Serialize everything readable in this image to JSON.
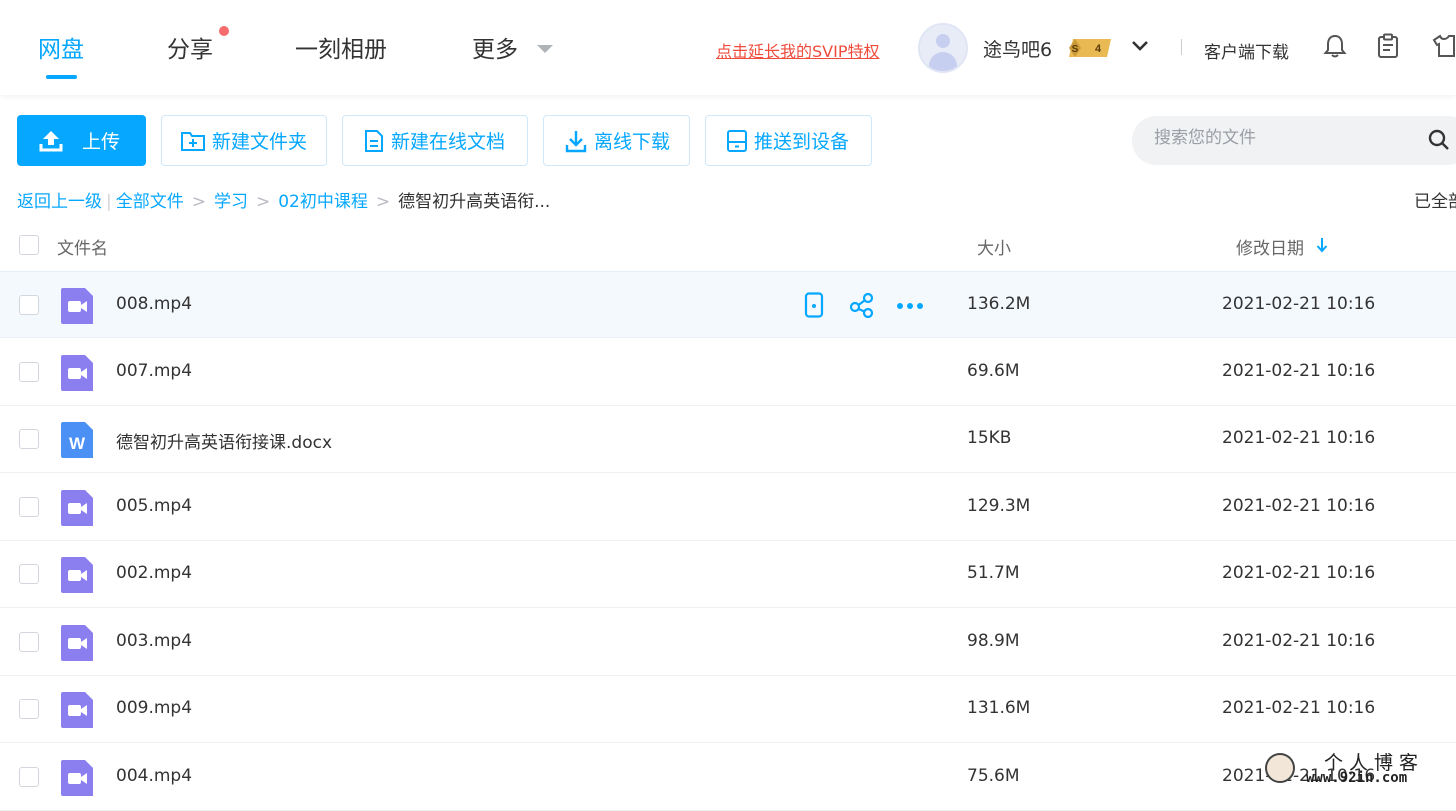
{
  "nav": {
    "tabs": [
      {
        "label": "网盘"
      },
      {
        "label": "分享"
      },
      {
        "label": "一刻相册"
      },
      {
        "label": "更多"
      }
    ],
    "svip_promo": "点击延长我的SVIP特权",
    "username": "途鸟吧6",
    "vip_badge": {
      "coin": "S",
      "level": "4"
    },
    "client_download": "客户端下载"
  },
  "toolbar": {
    "upload": "上传",
    "new_folder": "新建文件夹",
    "new_online_doc": "新建在线文档",
    "offline_download": "离线下载",
    "push_to_device": "推送到设备"
  },
  "search": {
    "placeholder": "搜索您的文件"
  },
  "breadcrumb": {
    "back": "返回上一级",
    "items": [
      "全部文件",
      "学习",
      "02初中课程"
    ],
    "current": "德智初升高英语衔...",
    "status": "已全部"
  },
  "table": {
    "headers": {
      "name": "文件名",
      "size": "大小",
      "modified": "修改日期"
    },
    "rows": [
      {
        "name": "008.mp4",
        "type": "video",
        "size": "136.2M",
        "date": "2021-02-21 10:16"
      },
      {
        "name": "007.mp4",
        "type": "video",
        "size": "69.6M",
        "date": "2021-02-21 10:16"
      },
      {
        "name": "德智初升高英语衔接课.docx",
        "type": "word",
        "size": "15KB",
        "date": "2021-02-21 10:16"
      },
      {
        "name": "005.mp4",
        "type": "video",
        "size": "129.3M",
        "date": "2021-02-21 10:16"
      },
      {
        "name": "002.mp4",
        "type": "video",
        "size": "51.7M",
        "date": "2021-02-21 10:16"
      },
      {
        "name": "003.mp4",
        "type": "video",
        "size": "98.9M",
        "date": "2021-02-21 10:16"
      },
      {
        "name": "009.mp4",
        "type": "video",
        "size": "131.6M",
        "date": "2021-02-21 10:16"
      },
      {
        "name": "004.mp4",
        "type": "video",
        "size": "75.6M",
        "date": "2021-02-21 10:16"
      }
    ]
  },
  "watermark": {
    "title": "个人博客",
    "url": "www.92in.com"
  },
  "colors": {
    "accent": "#06a7ff",
    "video_icon": "#8b7ff0",
    "word_icon": "#4a90f5",
    "promo": "#ef4c3c"
  }
}
